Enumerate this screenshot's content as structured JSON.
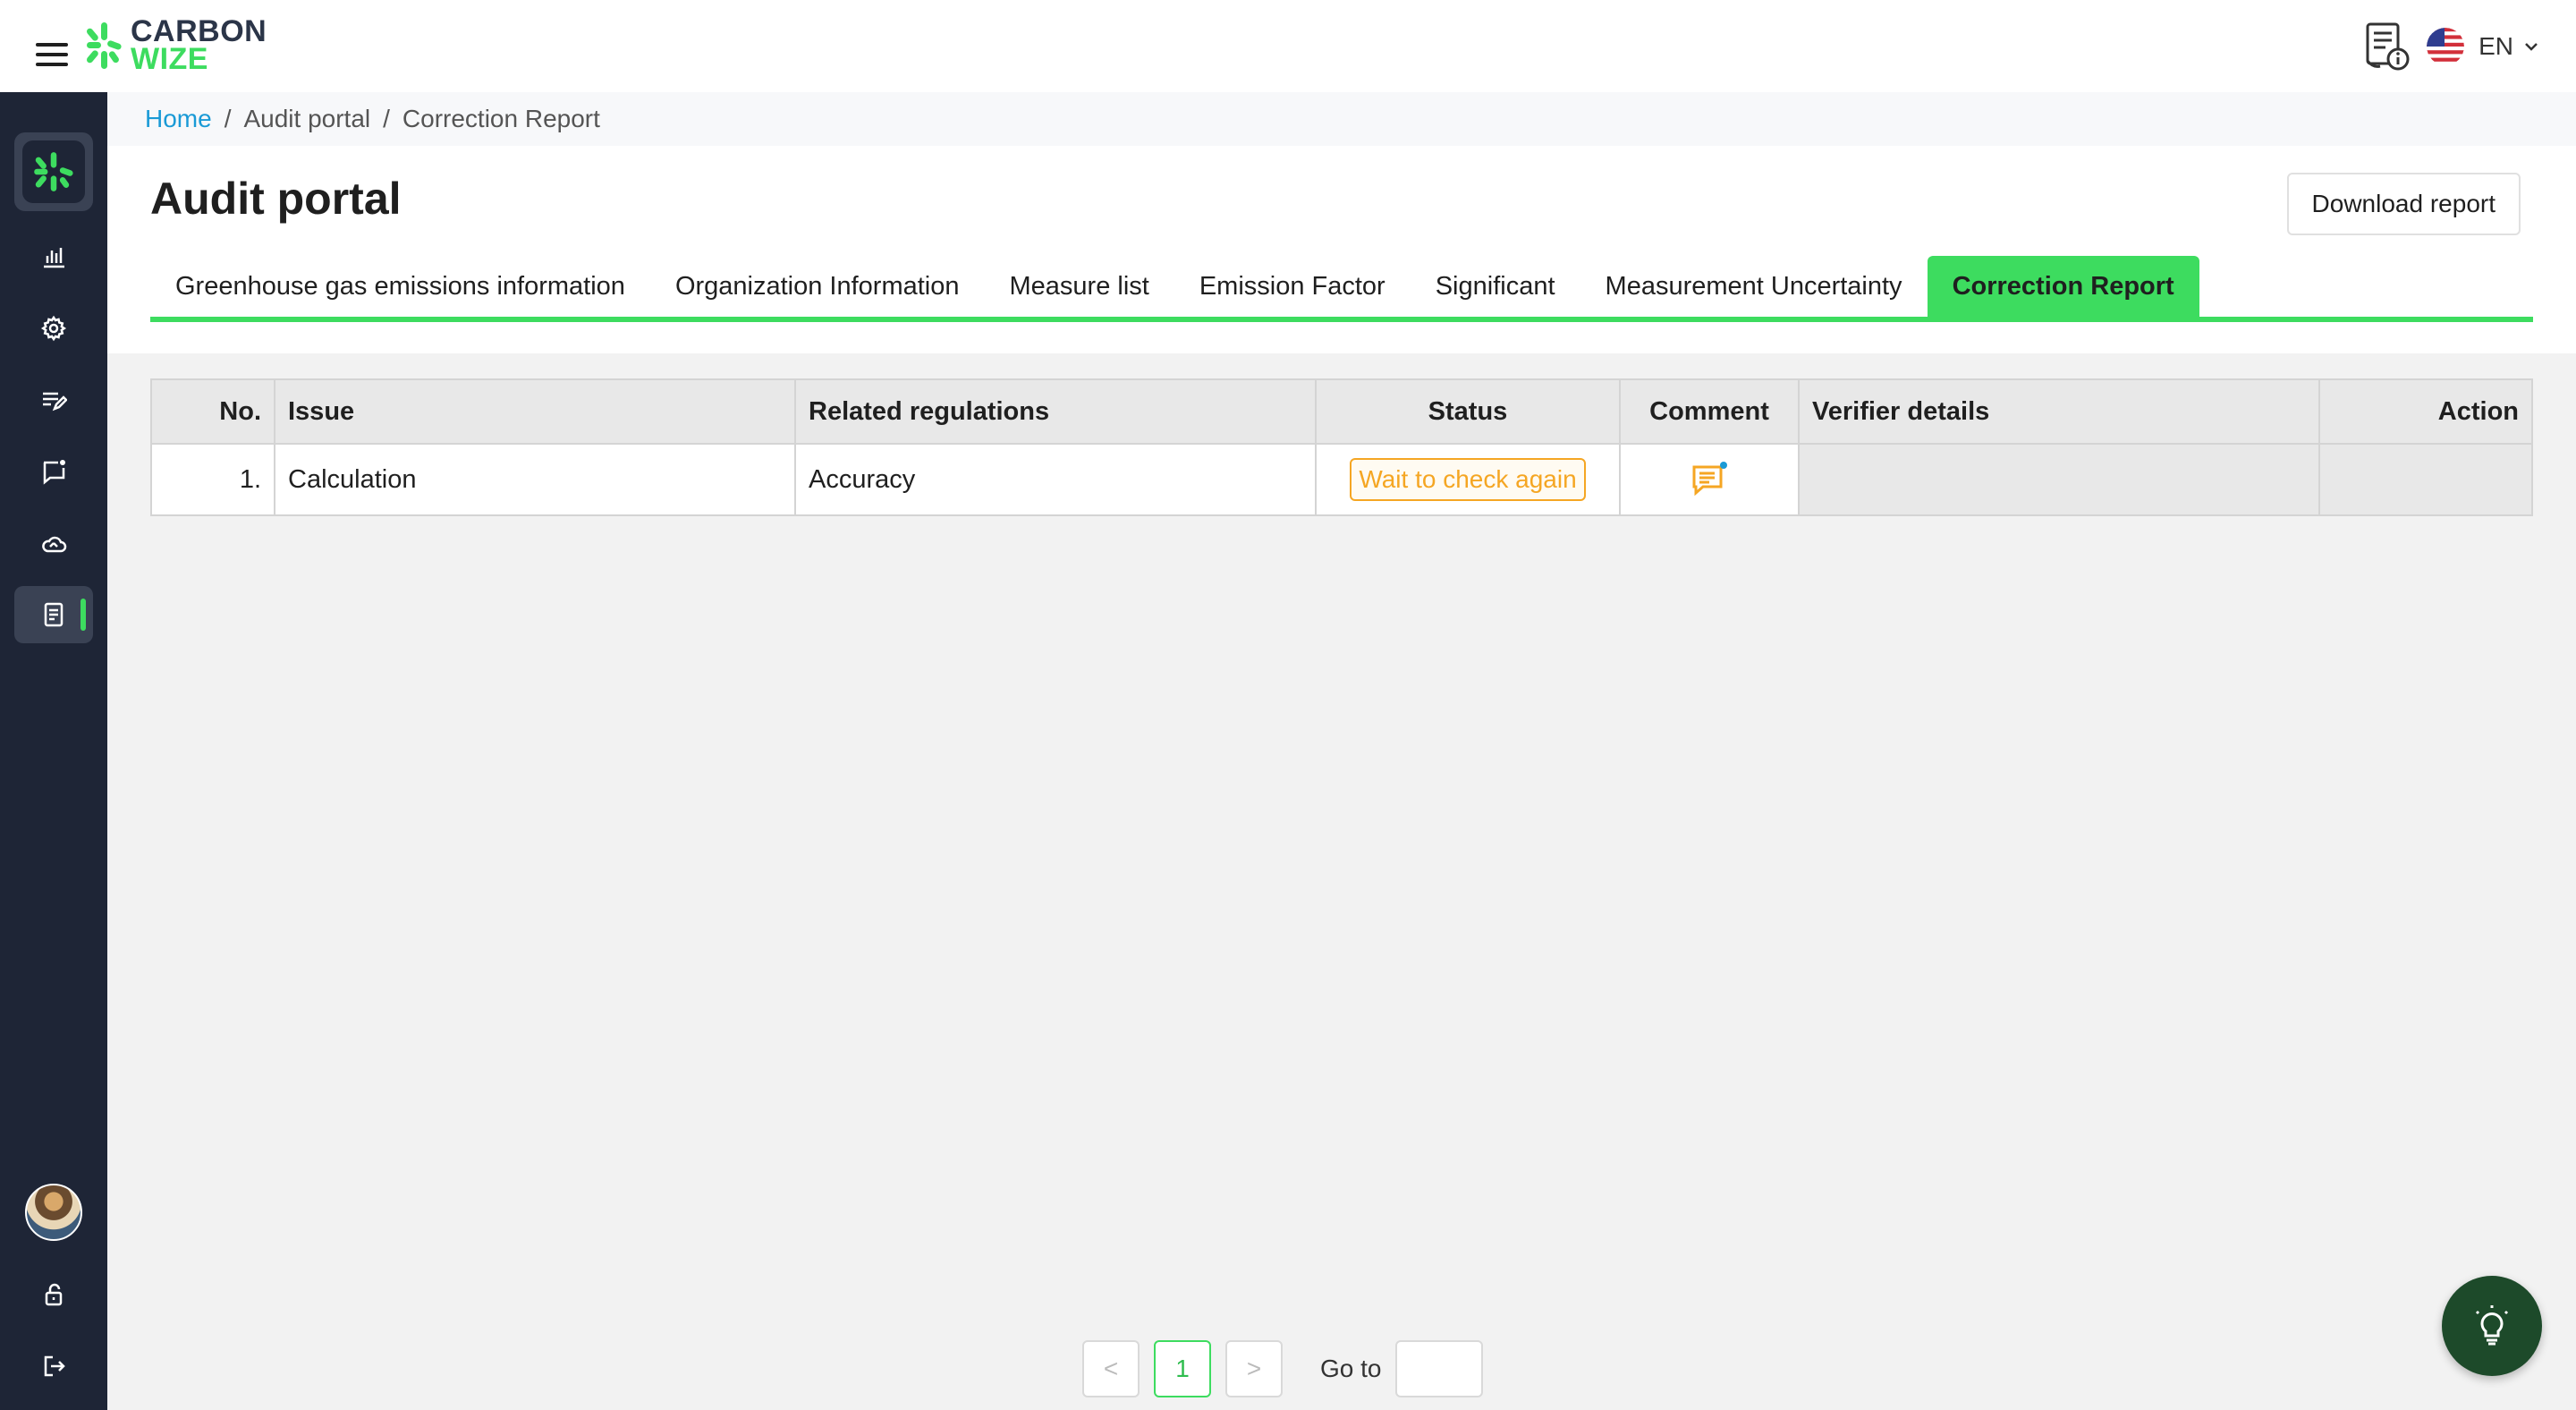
{
  "header": {
    "logo_line1": "CARBON",
    "logo_line2": "WIZE",
    "language": "EN",
    "icons": {
      "menu": "hamburger-menu-icon",
      "doc": "document-info-icon",
      "flag": "us-flag-icon",
      "chevron": "chevron-down-icon"
    }
  },
  "sidebar": {
    "items": [
      {
        "icon": "bar-chart-icon"
      },
      {
        "icon": "gear-icon"
      },
      {
        "icon": "edit-list-icon"
      },
      {
        "icon": "message-square-icon"
      },
      {
        "icon": "cloud-icon"
      },
      {
        "icon": "report-document-icon",
        "active": true
      }
    ],
    "bottom": [
      {
        "icon": "lock-open-icon"
      },
      {
        "icon": "logout-icon"
      }
    ]
  },
  "breadcrumb": {
    "home": "Home",
    "separator": "/",
    "parent": "Audit portal",
    "current": "Correction Report"
  },
  "page": {
    "title": "Audit portal",
    "download_label": "Download report"
  },
  "tabs": [
    {
      "label": "Greenhouse gas emissions information"
    },
    {
      "label": "Organization Information"
    },
    {
      "label": "Measure list"
    },
    {
      "label": "Emission Factor"
    },
    {
      "label": "Significant"
    },
    {
      "label": "Measurement Uncertainty"
    },
    {
      "label": "Correction Report",
      "active": true
    }
  ],
  "table": {
    "columns": {
      "no": "No.",
      "issue": "Issue",
      "regulations": "Related regulations",
      "status": "Status",
      "comment": "Comment",
      "verifier": "Verifier details",
      "action": "Action"
    },
    "rows": [
      {
        "no": "1.",
        "issue": "Calculation",
        "regulations": "Accuracy",
        "status": "Wait to check again",
        "verifier": "",
        "action": ""
      }
    ]
  },
  "colors": {
    "accent": "#3ddc5f",
    "sidebar_bg": "#1e2536",
    "status_warning": "#f5a623",
    "link": "#1a9ad6"
  },
  "pagination": {
    "prev": "<",
    "current_page": "1",
    "next": ">",
    "goto_label": "Go to",
    "goto_value": ""
  },
  "fab": {
    "icon": "lightbulb-icon"
  }
}
